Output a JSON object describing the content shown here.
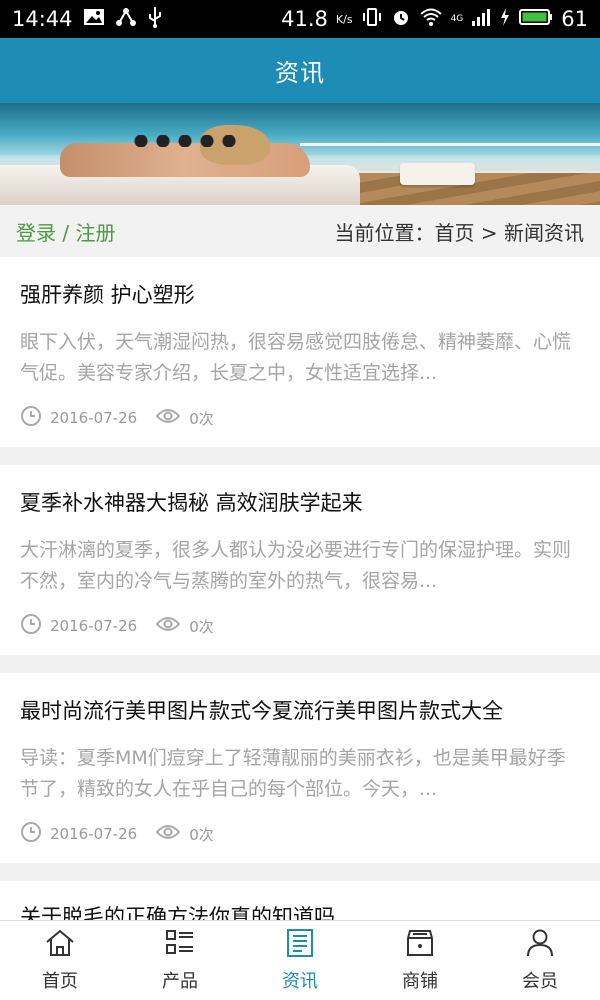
{
  "status_bar": {
    "time": "14:44",
    "speed": "41.8",
    "speed_unit": "K/s",
    "network": "4G",
    "battery": "61"
  },
  "header": {
    "title": "资讯"
  },
  "crumb": {
    "login_register": "登录 / 注册",
    "location": "当前位置：首页 > 新闻资讯"
  },
  "news": [
    {
      "title": "强肝养颜 护心塑形",
      "summary": "眼下入伏，天气潮湿闷热，很容易感觉四肢倦怠、精神萎靡、心慌气促。美容专家介绍，长夏之中，女性适宜选择...",
      "date": "2016-07-26",
      "views": "0次"
    },
    {
      "title": "夏季补水神器大揭秘 高效润肤学起来",
      "summary": "大汗淋漓的夏季，很多人都认为没必要进行专门的保湿护理。实则不然，室内的冷气与蒸腾的室外的热气，很容易...",
      "date": "2016-07-26",
      "views": "0次"
    },
    {
      "title": "最时尚流行美甲图片款式今夏流行美甲图片款式大全",
      "summary": "导读：夏季MM们痘穿上了轻薄靓丽的美丽衣衫，也是美甲最好季节了，精致的女人在乎自己的每个部位。今天，...",
      "date": "2016-07-26",
      "views": "0次"
    },
    {
      "title": "关于脱毛的正确方法你真的知道吗",
      "summary": "",
      "date": "",
      "views": ""
    }
  ],
  "tabs": [
    {
      "label": "首页",
      "icon": "home-icon",
      "active": false
    },
    {
      "label": "产品",
      "icon": "list-icon",
      "active": false
    },
    {
      "label": "资讯",
      "icon": "news-icon",
      "active": true
    },
    {
      "label": "商铺",
      "icon": "shop-icon",
      "active": false
    },
    {
      "label": "会员",
      "icon": "user-icon",
      "active": false
    }
  ],
  "colors": {
    "primary": "#1e8db5",
    "login": "#4a9c3c"
  }
}
